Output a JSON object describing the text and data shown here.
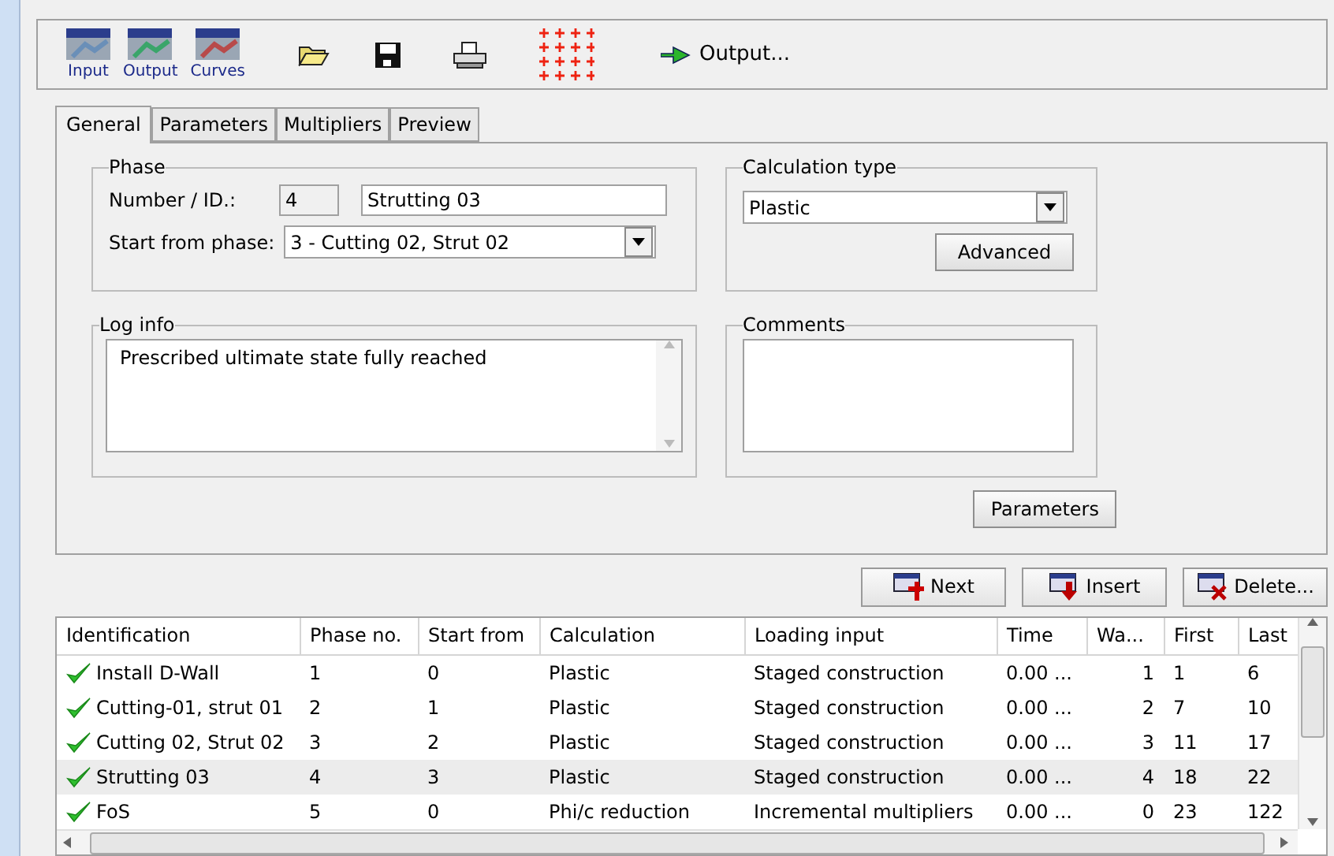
{
  "toolbar": {
    "apps": [
      {
        "kind": "input",
        "label": "Input"
      },
      {
        "kind": "output",
        "label": "Output"
      },
      {
        "kind": "curves",
        "label": "Curves"
      }
    ],
    "output_button": "Output..."
  },
  "tabs": [
    {
      "label": "General",
      "selected": true
    },
    {
      "label": "Parameters",
      "selected": false
    },
    {
      "label": "Multipliers",
      "selected": false
    },
    {
      "label": "Preview",
      "selected": false
    }
  ],
  "phase": {
    "title": "Phase",
    "number_label": "Number / ID.:",
    "number": "4",
    "name": "Strutting 03",
    "start_label": "Start from phase:",
    "start_value": "3 - Cutting 02, Strut 02"
  },
  "calculation_type": {
    "title": "Calculation type",
    "value": "Plastic",
    "advanced_button": "Advanced"
  },
  "log_info": {
    "title": "Log info",
    "text": "Prescribed ultimate state fully reached"
  },
  "comments": {
    "title": "Comments"
  },
  "parameters_button": "Parameters",
  "actions": [
    {
      "kind": "next",
      "label": "Next"
    },
    {
      "kind": "insert",
      "label": "Insert"
    },
    {
      "kind": "delete",
      "label": "Delete..."
    }
  ],
  "table": {
    "columns": [
      "Identification",
      "Phase no.",
      "Start from",
      "Calculation",
      "Loading input",
      "Time",
      "Wa...",
      "First",
      "Last"
    ],
    "rows": [
      {
        "selected": false,
        "cells": [
          "Install D-Wall",
          "1",
          "0",
          "Plastic",
          "Staged construction",
          "0.00 ...",
          "1",
          "1",
          "6"
        ]
      },
      {
        "selected": false,
        "cells": [
          "Cutting-01, strut 01",
          "2",
          "1",
          "Plastic",
          "Staged construction",
          "0.00 ...",
          "2",
          "7",
          "10"
        ]
      },
      {
        "selected": false,
        "cells": [
          "Cutting 02, Strut 02",
          "3",
          "2",
          "Plastic",
          "Staged construction",
          "0.00 ...",
          "3",
          "11",
          "17"
        ]
      },
      {
        "selected": true,
        "cells": [
          "Strutting 03",
          "4",
          "3",
          "Plastic",
          "Staged construction",
          "0.00 ...",
          "4",
          "18",
          "22"
        ]
      },
      {
        "selected": false,
        "cells": [
          "FoS",
          "5",
          "0",
          "Phi/c reduction",
          "Incremental multipliers",
          "0.00 ...",
          "0",
          "23",
          "122"
        ]
      }
    ]
  }
}
